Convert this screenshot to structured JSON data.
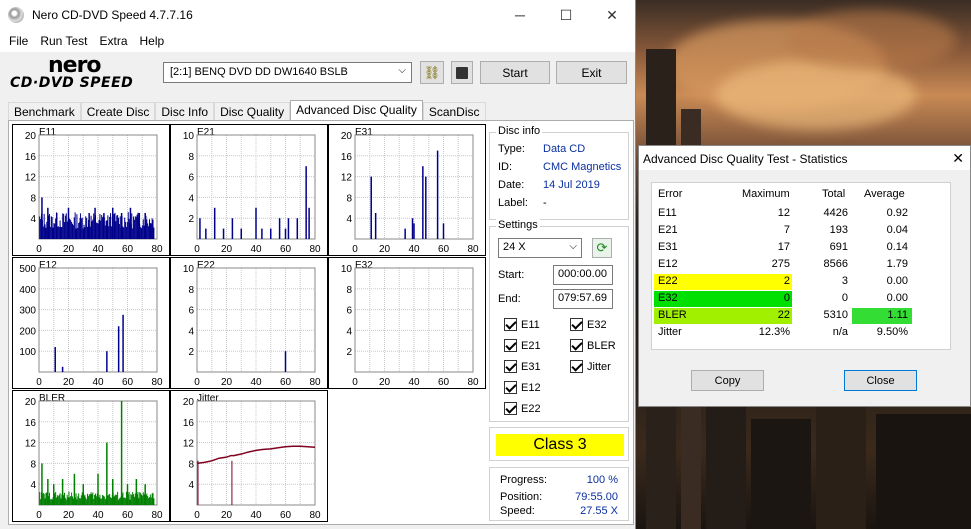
{
  "window": {
    "title": "Nero CD-DVD Speed 4.7.7.16",
    "minimize_icon": "minimize-icon",
    "maximize_icon": "maximize-icon",
    "close_icon": "close-icon"
  },
  "menu": [
    "File",
    "Run Test",
    "Extra",
    "Help"
  ],
  "logo": {
    "line1": "nero",
    "line2": "CD·DVD SPEED"
  },
  "drive": {
    "selected": "[2:1]   BENQ DVD DD DW1640 BSLB"
  },
  "toolbar": {
    "start": "Start",
    "exit": "Exit"
  },
  "tabs": [
    "Benchmark",
    "Create Disc",
    "Disc Info",
    "Disc Quality",
    "Advanced Disc Quality",
    "ScanDisc"
  ],
  "active_tab": "Advanced Disc Quality",
  "disc_info": {
    "title": "Disc info",
    "type_label": "Type:",
    "type": "Data CD",
    "id_label": "ID:",
    "id": "CMC Magnetics",
    "date_label": "Date:",
    "date": "14 Jul 2019",
    "label_label": "Label:",
    "label": "-"
  },
  "settings": {
    "title": "Settings",
    "speed": "24 X",
    "start_label": "Start:",
    "start": "000:00.00",
    "end_label": "End:",
    "end": "079:57.69",
    "checks": [
      "E11",
      "E32",
      "E21",
      "BLER",
      "E31",
      "Jitter",
      "E12",
      "E22"
    ]
  },
  "class": "Class 3",
  "progress": {
    "progress_label": "Progress:",
    "progress": "100 %",
    "position_label": "Position:",
    "position": "79:55.00",
    "speed_label": "Speed:",
    "speed": "27.55 X"
  },
  "chart_data": [
    {
      "type": "bar",
      "title": "E11",
      "ylim": [
        0,
        20
      ],
      "yticks": [
        "20",
        "16",
        "12",
        "8",
        "4"
      ],
      "xticks": [
        "0",
        "20",
        "40",
        "60",
        "80"
      ],
      "color": "#00008b",
      "baseline": 2,
      "spikes": [
        [
          2,
          8
        ],
        [
          6,
          6
        ],
        [
          12,
          5
        ],
        [
          20,
          6
        ],
        [
          28,
          4
        ],
        [
          34,
          5
        ],
        [
          38,
          6
        ],
        [
          44,
          5
        ],
        [
          50,
          6
        ],
        [
          56,
          5
        ],
        [
          62,
          6
        ],
        [
          68,
          5
        ],
        [
          72,
          5
        ],
        [
          76,
          3
        ]
      ]
    },
    {
      "type": "bar",
      "title": "E21",
      "ylim": [
        0,
        10
      ],
      "yticks": [
        "10",
        "8",
        "6",
        "4",
        "2"
      ],
      "xticks": [
        "0",
        "20",
        "40",
        "60",
        "80"
      ],
      "color": "#00008b",
      "baseline": 0,
      "spikes": [
        [
          2,
          2
        ],
        [
          6,
          1
        ],
        [
          12,
          3
        ],
        [
          18,
          1
        ],
        [
          24,
          2
        ],
        [
          30,
          1
        ],
        [
          40,
          3
        ],
        [
          44,
          1
        ],
        [
          50,
          1
        ],
        [
          56,
          2
        ],
        [
          60,
          1
        ],
        [
          62,
          2
        ],
        [
          68,
          2
        ],
        [
          74,
          7
        ],
        [
          76,
          3
        ]
      ]
    },
    {
      "type": "bar",
      "title": "E31",
      "ylim": [
        0,
        20
      ],
      "yticks": [
        "20",
        "16",
        "12",
        "8",
        "4"
      ],
      "xticks": [
        "0",
        "20",
        "40",
        "60",
        "80"
      ],
      "color": "#00008b",
      "baseline": 0,
      "spikes": [
        [
          11,
          12
        ],
        [
          14,
          5
        ],
        [
          34,
          2
        ],
        [
          39,
          4
        ],
        [
          40,
          3
        ],
        [
          46,
          14
        ],
        [
          48,
          12
        ],
        [
          56,
          17
        ],
        [
          60,
          3
        ]
      ]
    },
    {
      "type": "bar",
      "title": "E12",
      "ylim": [
        0,
        500
      ],
      "yticks": [
        "500",
        "400",
        "300",
        "200",
        "100"
      ],
      "xticks": [
        "0",
        "20",
        "40",
        "60",
        "80"
      ],
      "color": "#00008b",
      "baseline": 0,
      "spikes": [
        [
          11,
          120
        ],
        [
          16,
          25
        ],
        [
          46,
          100
        ],
        [
          54,
          220
        ],
        [
          57,
          275
        ]
      ]
    },
    {
      "type": "bar",
      "title": "E22",
      "ylim": [
        0,
        10
      ],
      "yticks": [
        "10",
        "8",
        "6",
        "4",
        "2"
      ],
      "xticks": [
        "0",
        "20",
        "40",
        "60",
        "80"
      ],
      "color": "#00008b",
      "baseline": 0,
      "spikes": [
        [
          60,
          2
        ]
      ]
    },
    {
      "type": "bar",
      "title": "E32",
      "ylim": [
        0,
        10
      ],
      "yticks": [
        "10",
        "8",
        "6",
        "4",
        "2"
      ],
      "xticks": [
        "0",
        "20",
        "40",
        "60",
        "80"
      ],
      "color": "#00008b",
      "baseline": 0,
      "spikes": []
    },
    {
      "type": "bar",
      "title": "BLER",
      "ylim": [
        0,
        20
      ],
      "yticks": [
        "20",
        "16",
        "12",
        "8",
        "4"
      ],
      "xticks": [
        "0",
        "20",
        "40",
        "60",
        "80"
      ],
      "color": "#008000",
      "baseline": 1,
      "spikes": [
        [
          2,
          8
        ],
        [
          6,
          5
        ],
        [
          10,
          4
        ],
        [
          16,
          5
        ],
        [
          24,
          6
        ],
        [
          30,
          4
        ],
        [
          40,
          6
        ],
        [
          46,
          12
        ],
        [
          50,
          5
        ],
        [
          56,
          22
        ],
        [
          60,
          4
        ],
        [
          66,
          5
        ],
        [
          72,
          4
        ]
      ]
    },
    {
      "type": "line",
      "title": "Jitter",
      "ylim": [
        0,
        20
      ],
      "yticks": [
        "20",
        "16",
        "12",
        "8",
        "4"
      ],
      "xticks": [
        "0",
        "20",
        "40",
        "60",
        "80"
      ],
      "color": "#800020",
      "points": [
        [
          0,
          8
        ],
        [
          5,
          8.2
        ],
        [
          10,
          8.5
        ],
        [
          15,
          9
        ],
        [
          20,
          9.2
        ],
        [
          23,
          9.5
        ],
        [
          25,
          9.5
        ],
        [
          30,
          9.8
        ],
        [
          35,
          10.2
        ],
        [
          40,
          10.5
        ],
        [
          45,
          10.7
        ],
        [
          50,
          10.8
        ],
        [
          55,
          11
        ],
        [
          60,
          11.2
        ],
        [
          65,
          11.3
        ],
        [
          70,
          11.3
        ],
        [
          75,
          11.2
        ],
        [
          80,
          11.1
        ]
      ],
      "drops": [
        [
          0,
          0
        ],
        [
          23,
          0
        ]
      ]
    }
  ],
  "stats": {
    "title": "Advanced Disc Quality Test - Statistics",
    "headers": [
      "Error",
      "Maximum",
      "Total",
      "Average"
    ],
    "rows": [
      {
        "name": "E11",
        "max": "12",
        "total": "4426",
        "avg": "0.92",
        "hl": "",
        "avg_hl": ""
      },
      {
        "name": "E21",
        "max": "7",
        "total": "193",
        "avg": "0.04",
        "hl": "",
        "avg_hl": ""
      },
      {
        "name": "E31",
        "max": "17",
        "total": "691",
        "avg": "0.14",
        "hl": "",
        "avg_hl": ""
      },
      {
        "name": "E12",
        "max": "275",
        "total": "8566",
        "avg": "1.79",
        "hl": "",
        "avg_hl": ""
      },
      {
        "name": "E22",
        "max": "2",
        "total": "3",
        "avg": "0.00",
        "hl": "#ffff00",
        "avg_hl": ""
      },
      {
        "name": "E32",
        "max": "0",
        "total": "0",
        "avg": "0.00",
        "hl": "#00e000",
        "avg_hl": ""
      },
      {
        "name": "BLER",
        "max": "22",
        "total": "5310",
        "avg": "1.11",
        "hl": "#a0f000",
        "avg_hl": "#33dd33"
      },
      {
        "name": "Jitter",
        "max": "12.3%",
        "total": "n/a",
        "avg": "9.50%",
        "hl": "",
        "avg_hl": ""
      }
    ],
    "copy": "Copy",
    "close": "Close"
  }
}
